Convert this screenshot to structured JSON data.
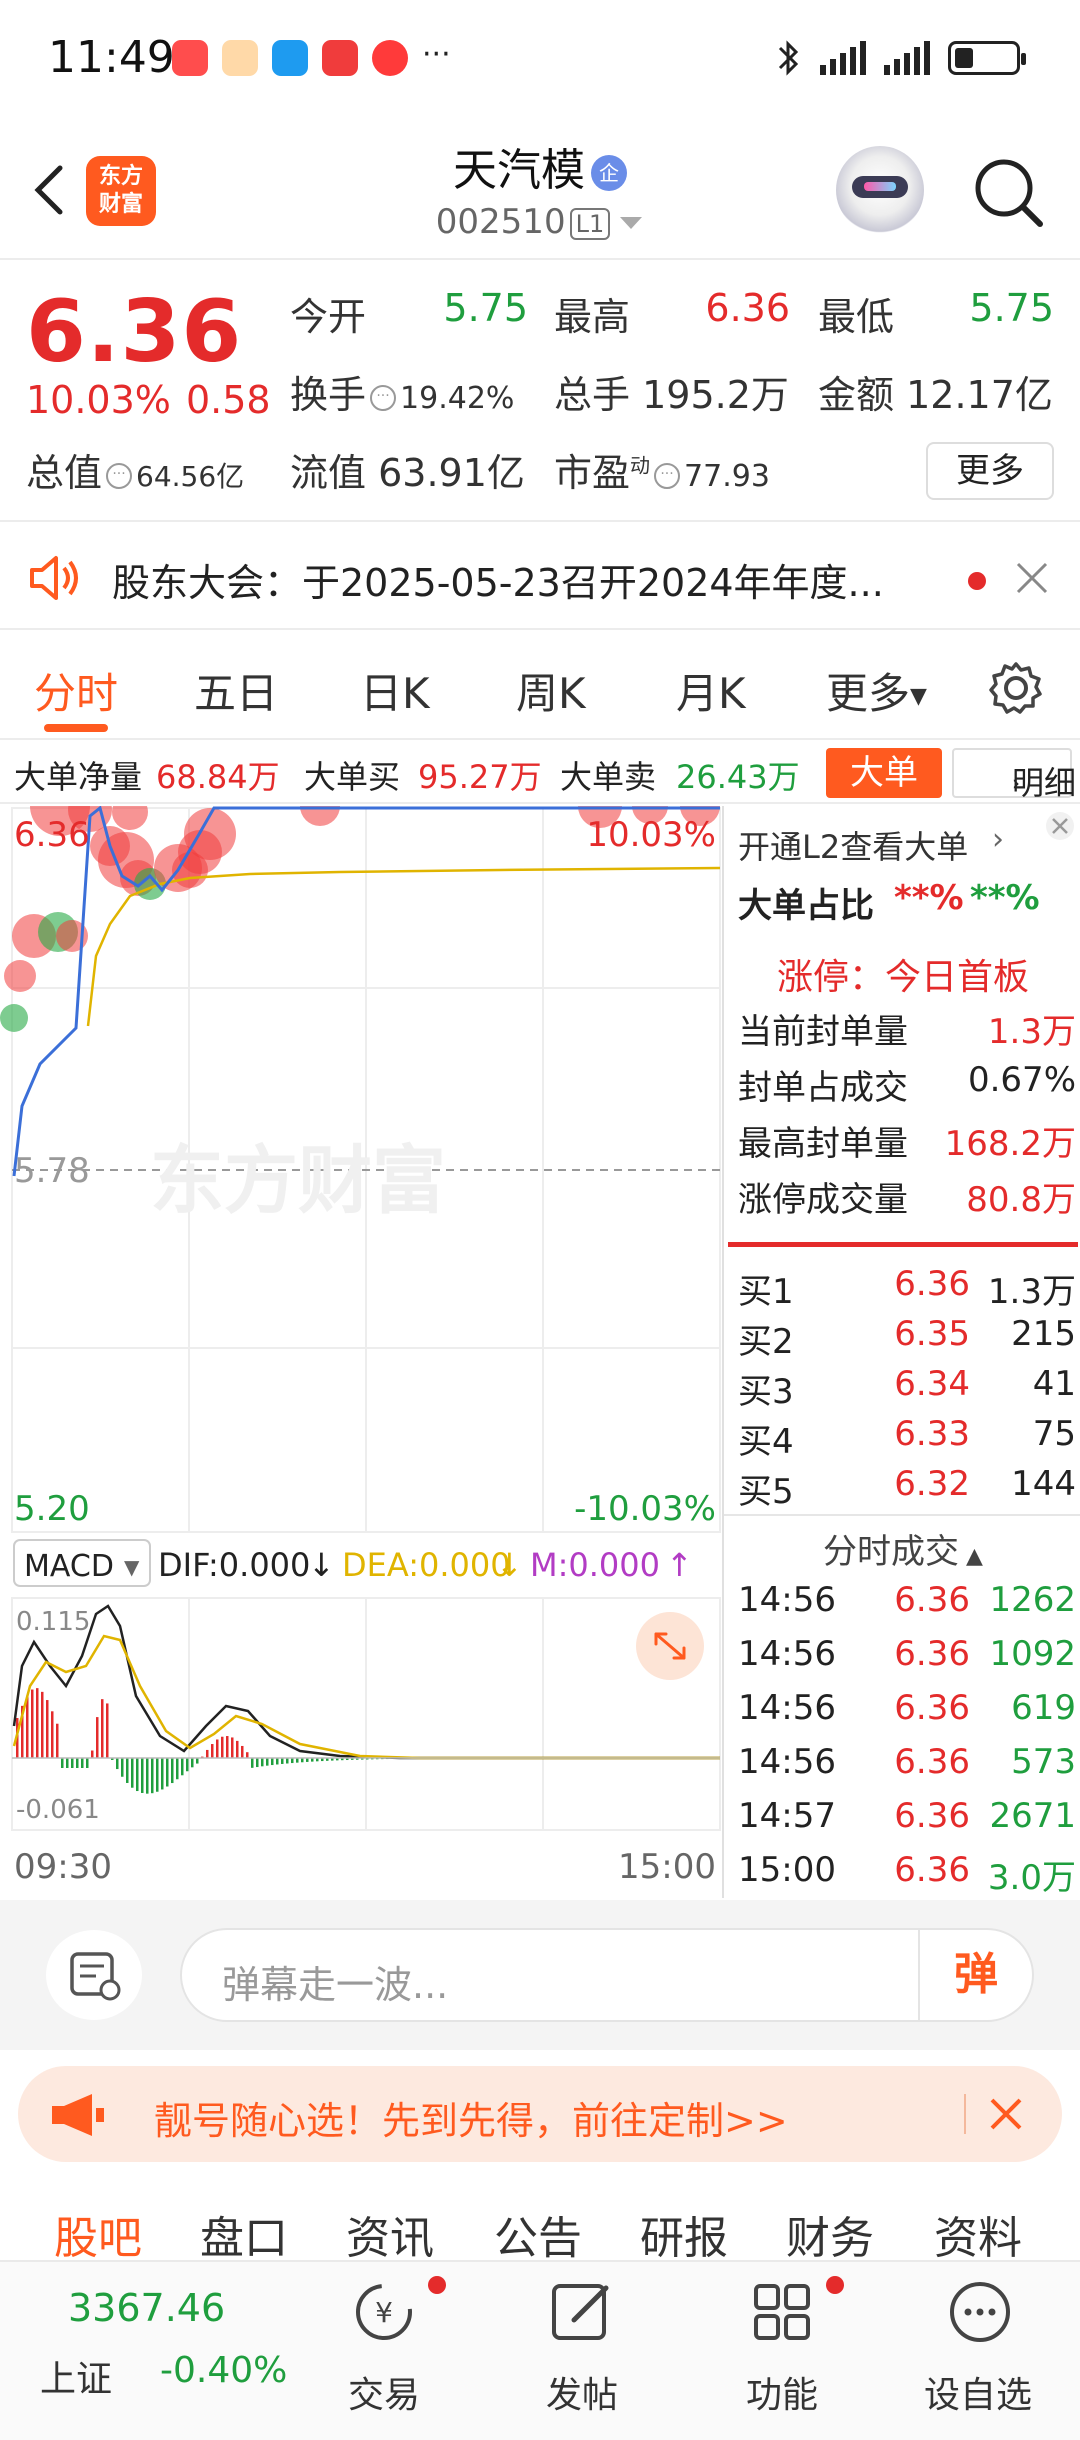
{
  "status_bar": {
    "time": "11:49",
    "more": "···"
  },
  "header": {
    "title": "天汽模",
    "title_badge": "企",
    "stock_code": "002510",
    "level": "L1",
    "logo_text_1": "东方",
    "logo_text_2": "财富"
  },
  "quote": {
    "price": "6.36",
    "change_pct": "10.03%",
    "change": "0.58",
    "open_label": "今开",
    "open": "5.75",
    "high_label": "最高",
    "high": "6.36",
    "low_label": "最低",
    "low": "5.75",
    "turnover_label": "换手",
    "turnover": "19.42%",
    "volume_label": "总手",
    "volume": "195.2万",
    "amount_label": "金额",
    "amount": "12.17亿",
    "total_value_label": "总值",
    "total_value": "64.56亿",
    "float_value_label": "流值",
    "float_value": "63.91亿",
    "pe_label": "市盈",
    "pe_sup": "动",
    "pe": "77.93",
    "more_label": "更多"
  },
  "notice": {
    "text": "股东大会：于2025-05-23召开2024年年度..."
  },
  "tabs": [
    "分时",
    "五日",
    "日K",
    "周K",
    "月K",
    "更多"
  ],
  "big_orders": {
    "net_label": "大单净量",
    "net": "68.84万",
    "buy_label": "大单买",
    "buy": "95.27万",
    "sell_label": "大单卖",
    "sell": "26.43万",
    "big_btn": "大单",
    "detail_btn": "明细"
  },
  "chart": {
    "price_top": "6.36",
    "pct_top": "10.03%",
    "mid_price": "5.78",
    "price_bottom": "5.20",
    "pct_bottom": "-10.03%",
    "watermark": "东方财富",
    "macd_label": "MACD",
    "dif": "DIF:0.000",
    "dea": "DEA:0.000",
    "m": "M:0.000",
    "macd_top": "0.115",
    "macd_bottom": "-0.061",
    "time_start": "09:30",
    "time_end": "15:00"
  },
  "chart_data": {
    "type": "line",
    "title": "",
    "ylim": [
      5.2,
      6.36
    ],
    "x": [
      "09:30",
      "15:00"
    ],
    "series": [
      {
        "name": "",
        "values": [
          5.78,
          6.36
        ]
      }
    ]
  },
  "side": {
    "l2_link": "开通L2查看大单",
    "ratio_label": "大单占比",
    "ratio_buy": "**%",
    "ratio_sell": "**%",
    "limit_up_title": "涨停：今日首板",
    "seal_label": "当前封单量",
    "seal": "1.3万",
    "seal_ratio_label": "封单占成交",
    "seal_ratio": "0.67%",
    "max_seal_label": "最高封单量",
    "max_seal": "168.2万",
    "limit_vol_label": "涨停成交量",
    "limit_vol": "80.8万",
    "bids": [
      {
        "label": "买1",
        "price": "6.36",
        "vol": "1.3万"
      },
      {
        "label": "买2",
        "price": "6.35",
        "vol": "215"
      },
      {
        "label": "买3",
        "price": "6.34",
        "vol": "41"
      },
      {
        "label": "买4",
        "price": "6.33",
        "vol": "75"
      },
      {
        "label": "买5",
        "price": "6.32",
        "vol": "144"
      }
    ],
    "trades_title": "分时成交",
    "trades": [
      {
        "time": "14:56",
        "price": "6.36",
        "vol": "1262"
      },
      {
        "time": "14:56",
        "price": "6.36",
        "vol": "1092"
      },
      {
        "time": "14:56",
        "price": "6.36",
        "vol": "619"
      },
      {
        "time": "14:56",
        "price": "6.36",
        "vol": "573"
      },
      {
        "time": "14:57",
        "price": "6.36",
        "vol": "2671"
      },
      {
        "time": "15:00",
        "price": "6.36",
        "vol": "3.0万"
      }
    ]
  },
  "comment": {
    "placeholder": "弹幕走一波...",
    "danmu_btn": "弹"
  },
  "promo": {
    "text": "靓号随心选！先到先得，前往定制>>"
  },
  "subtabs": [
    "股吧",
    "盘口",
    "资讯",
    "公告",
    "研报",
    "财务",
    "资料"
  ],
  "bottom_nav": {
    "index_value": "3367.46",
    "index_name": "上证",
    "index_change": "-0.40%",
    "items": [
      "交易",
      "发帖",
      "功能",
      "设自选"
    ]
  },
  "colors": {
    "accent": "#ff5a1f",
    "up": "#e42b2b",
    "down": "#1f9e3e",
    "avg_line": "#e0b400"
  }
}
